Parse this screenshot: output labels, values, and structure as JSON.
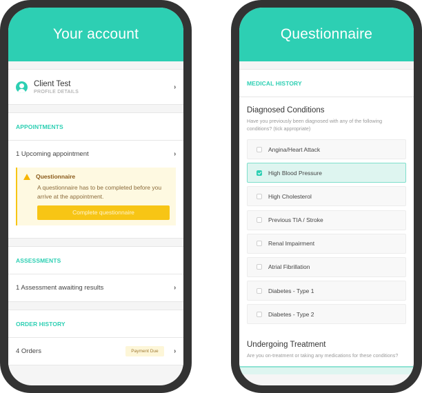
{
  "account": {
    "title": "Your account",
    "profile": {
      "name": "Client Test",
      "subtitle": "PROFILE DETAILS"
    },
    "appointments": {
      "section_title": "APPOINTMENTS",
      "item": "1 Upcoming appointment",
      "alert": {
        "title": "Questionnaire",
        "text": "A questionnaire has to be completed before you arrive at the appointment.",
        "button_label": "Complete questionnaire"
      }
    },
    "assessments": {
      "section_title": "ASSESSMENTS",
      "item": "1 Assessment awaiting results"
    },
    "order_history": {
      "section_title": "ORDER HISTORY",
      "item": "4 Orders",
      "badge": "Payment Due"
    },
    "chevron": "›"
  },
  "questionnaire": {
    "title": "Questionnaire",
    "section_title": "MEDICAL HISTORY",
    "diagnosed": {
      "heading": "Diagnosed Conditions",
      "prompt": "Have you previously been diagnosed with any of the following conditions? (tick appropriate)",
      "options": [
        {
          "label": "Angina/Heart Attack",
          "checked": false
        },
        {
          "label": "High Blood Pressure",
          "checked": true
        },
        {
          "label": "High Cholesterol",
          "checked": false
        },
        {
          "label": "Previous TIA / Stroke",
          "checked": false
        },
        {
          "label": "Renal Impairment",
          "checked": false
        },
        {
          "label": "Atrial Fibrillation",
          "checked": false
        },
        {
          "label": "Diabetes - Type 1",
          "checked": false
        },
        {
          "label": "Diabetes - Type 2",
          "checked": false
        }
      ]
    },
    "treatment": {
      "heading": "Undergoing Treatment",
      "prompt": "Are you on-treatment or taking any medications for these conditions?"
    }
  },
  "colors": {
    "brand": "#2dcfb3",
    "warning": "#f7c515",
    "alert_bg": "#fef9e1"
  }
}
